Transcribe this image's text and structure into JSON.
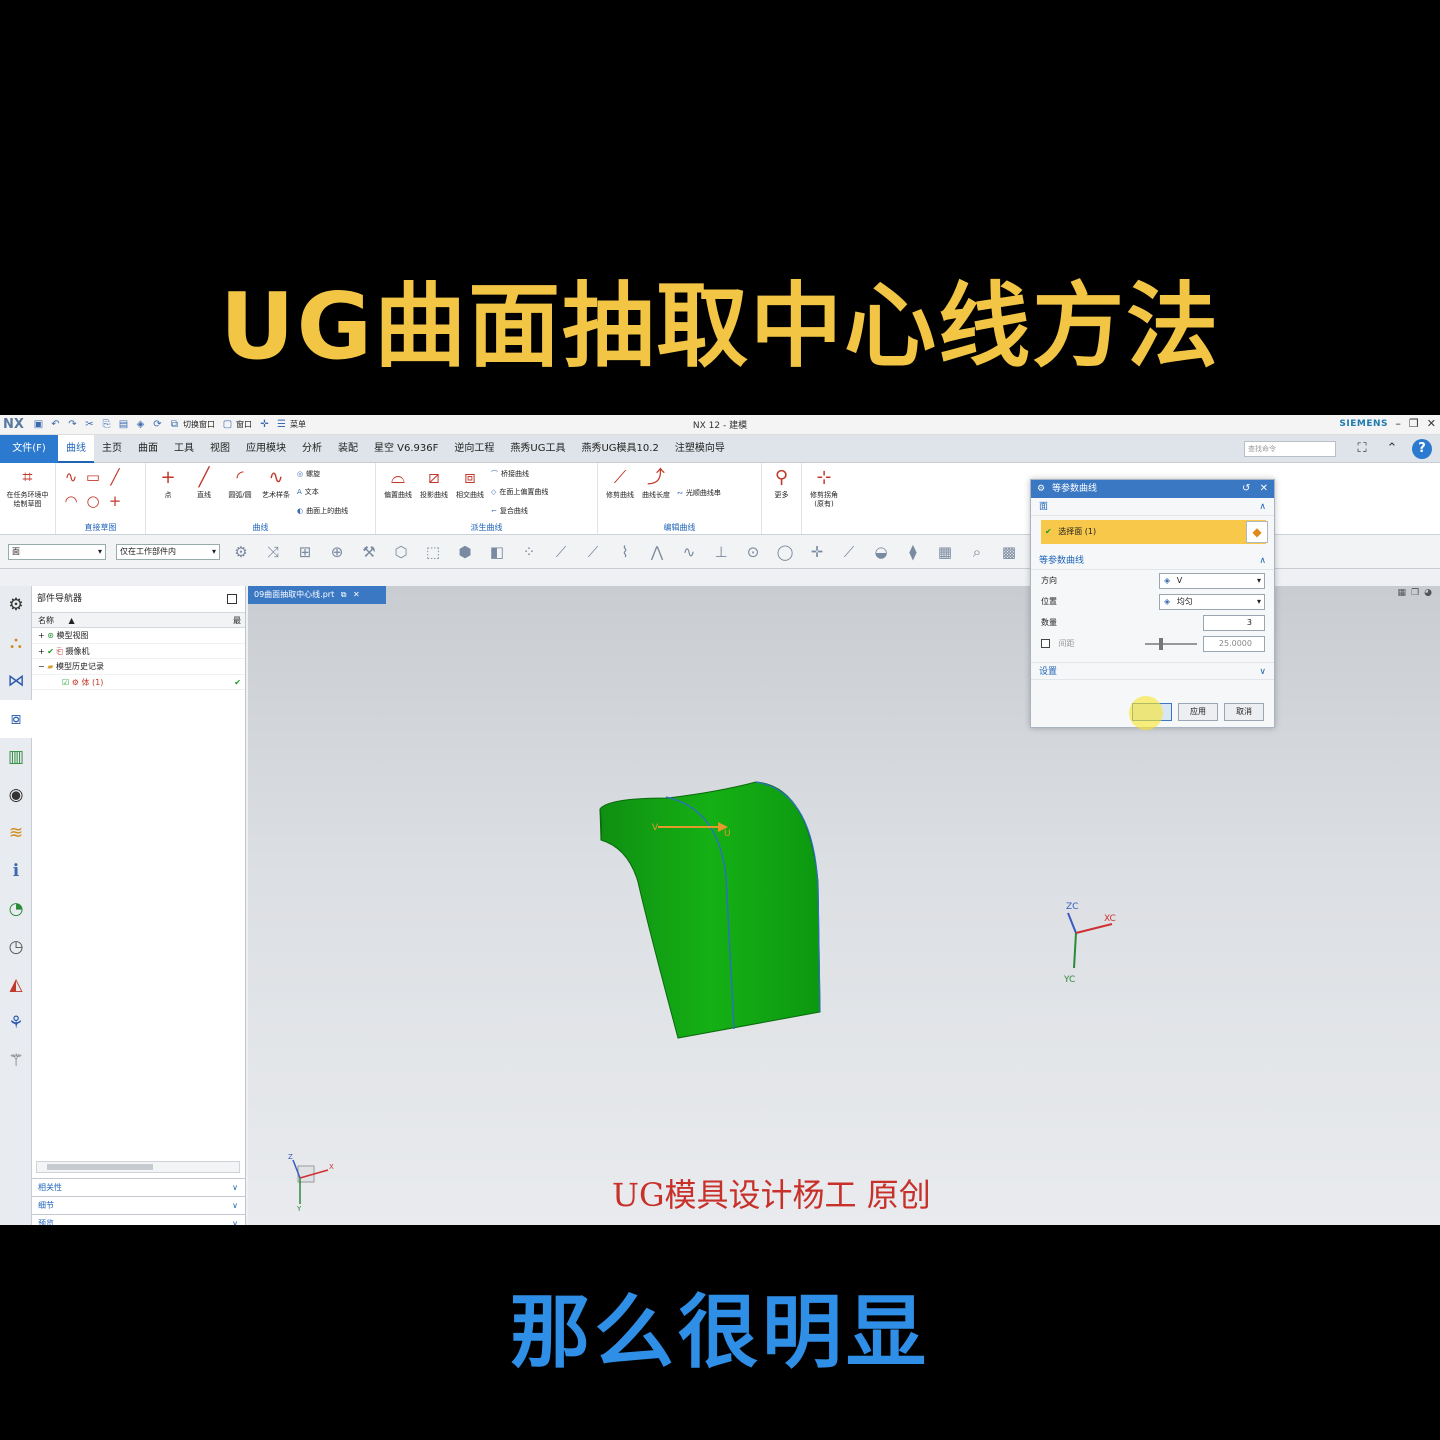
{
  "video": {
    "title": "UG曲面抽取中心线方法",
    "subtitle": "那么很明显",
    "watermark": "UG模具设计杨工 原创"
  },
  "titlebar": {
    "logo": "NX",
    "switch_window": "切换窗口",
    "window": "窗口",
    "menu": "菜单",
    "title": "NX 12 - 建模",
    "brand": "SIEMENS"
  },
  "menubar": {
    "file": "文件(F)",
    "tabs": [
      "曲线",
      "主页",
      "曲面",
      "工具",
      "视图",
      "应用模块",
      "分析",
      "装配",
      "星空 V6.936F",
      "逆向工程",
      "燕秀UG工具",
      "燕秀UG模具10.2",
      "注塑模向导"
    ],
    "active_tab": 0,
    "search_placeholder": "查找命令"
  },
  "ribbon": {
    "sketch_task": "在任务环境中绘制草图",
    "direct_sketch": "直接草图",
    "point": "点",
    "line": "直线",
    "arc": "圆弧/圆",
    "studio_spline": "艺术样条",
    "helix": "螺旋",
    "text": "文本",
    "curve_on_surface": "曲面上的曲线",
    "curve_group": "曲线",
    "offset_curve": "偏置曲线",
    "projected_curve": "投影曲线",
    "intersection_curve": "相交曲线",
    "bridge_curve": "桥接曲线",
    "offset_in_face": "在面上偏置曲线",
    "composite_curve": "复合曲线",
    "derived_group": "派生曲线",
    "trim_curve": "修剪曲线",
    "curve_length": "曲线长度",
    "smooth_string": "光顺曲线串",
    "edit_group": "编辑曲线",
    "more": "更多",
    "trim_corner": "修剪拐角(原有)"
  },
  "selbar": {
    "filter": "面",
    "scope": "仅在工作部件内"
  },
  "navigator": {
    "title": "部件导航器",
    "col_name": "名称",
    "col_latest": "最",
    "items": [
      {
        "label": "模型视图",
        "prefix": "+"
      },
      {
        "label": "摄像机",
        "prefix": "+"
      },
      {
        "label": "模型历史记录",
        "prefix": "−"
      },
      {
        "label": "体 (1)",
        "prefix": ""
      }
    ],
    "sections": [
      "相关性",
      "细节",
      "预览"
    ]
  },
  "graphics": {
    "doc_tab": "09曲面抽取中心线.prt",
    "triad": {
      "zc": "ZC",
      "xc": "XC",
      "yc": "YC"
    },
    "surface_labels": {
      "v": "V",
      "u": "U"
    },
    "mini_triad": {
      "z": "Z",
      "x": "X",
      "y": "Y"
    }
  },
  "dialog": {
    "title": "等参数曲线",
    "face_section": "面",
    "select_face": "选择面 (1)",
    "iso_section": "等参数曲线",
    "direction_label": "方向",
    "direction_value": "V",
    "position_label": "位置",
    "position_value": "均匀",
    "count_label": "数量",
    "count_value": "3",
    "spacing_label": "间距",
    "spacing_value": "25.0000",
    "settings_section": "设置",
    "ok": "",
    "apply": "应用",
    "cancel": "取消"
  },
  "colors": {
    "title_yellow": "#f2c544",
    "subtitle_blue": "#2f8fe6",
    "accent_blue": "#3b78c4",
    "surface_green": "#11a812",
    "watermark_red": "#c8302a"
  }
}
